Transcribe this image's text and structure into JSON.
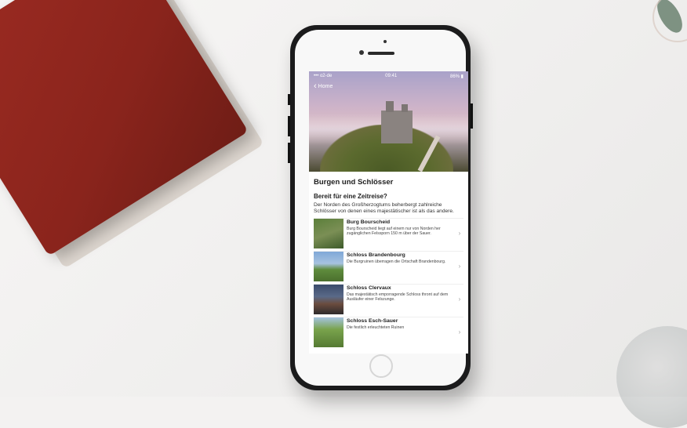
{
  "statusbar": {
    "left": "••• o2-de",
    "time": "09:41",
    "right": "86% ▮"
  },
  "nav": {
    "back_label": "Home",
    "back_icon": "chevron-left-icon"
  },
  "page": {
    "title": "Burgen und Schlösser",
    "intro_heading": "Bereit für eine Zeitreise?",
    "intro_text": "Der Norden des Großherzogtums beherbergt zahlreiche Schlösser von denen eines majestätischer ist als das andere."
  },
  "items": [
    {
      "title": "Burg Bourscheid",
      "desc": "Burg Bourscheid liegt auf einem nur von Norden her zugänglichen Felssporn 150 m über der Sauer."
    },
    {
      "title": "Schloss Brandenbourg",
      "desc": "Die Burgruinen überragen die Ortschaft Brandenbourg."
    },
    {
      "title": "Schloss Clervaux",
      "desc": "Das majestätisch emporragende Schloss thront auf dem Ausläufer einer Felszunge."
    },
    {
      "title": "Schloss Esch-Sauer",
      "desc": "Die festlich erleuchteten Ruinen"
    }
  ],
  "colors": {
    "notebook": "#8a241c",
    "phone": "#1b1b1c",
    "background": "#f3f2f1"
  }
}
